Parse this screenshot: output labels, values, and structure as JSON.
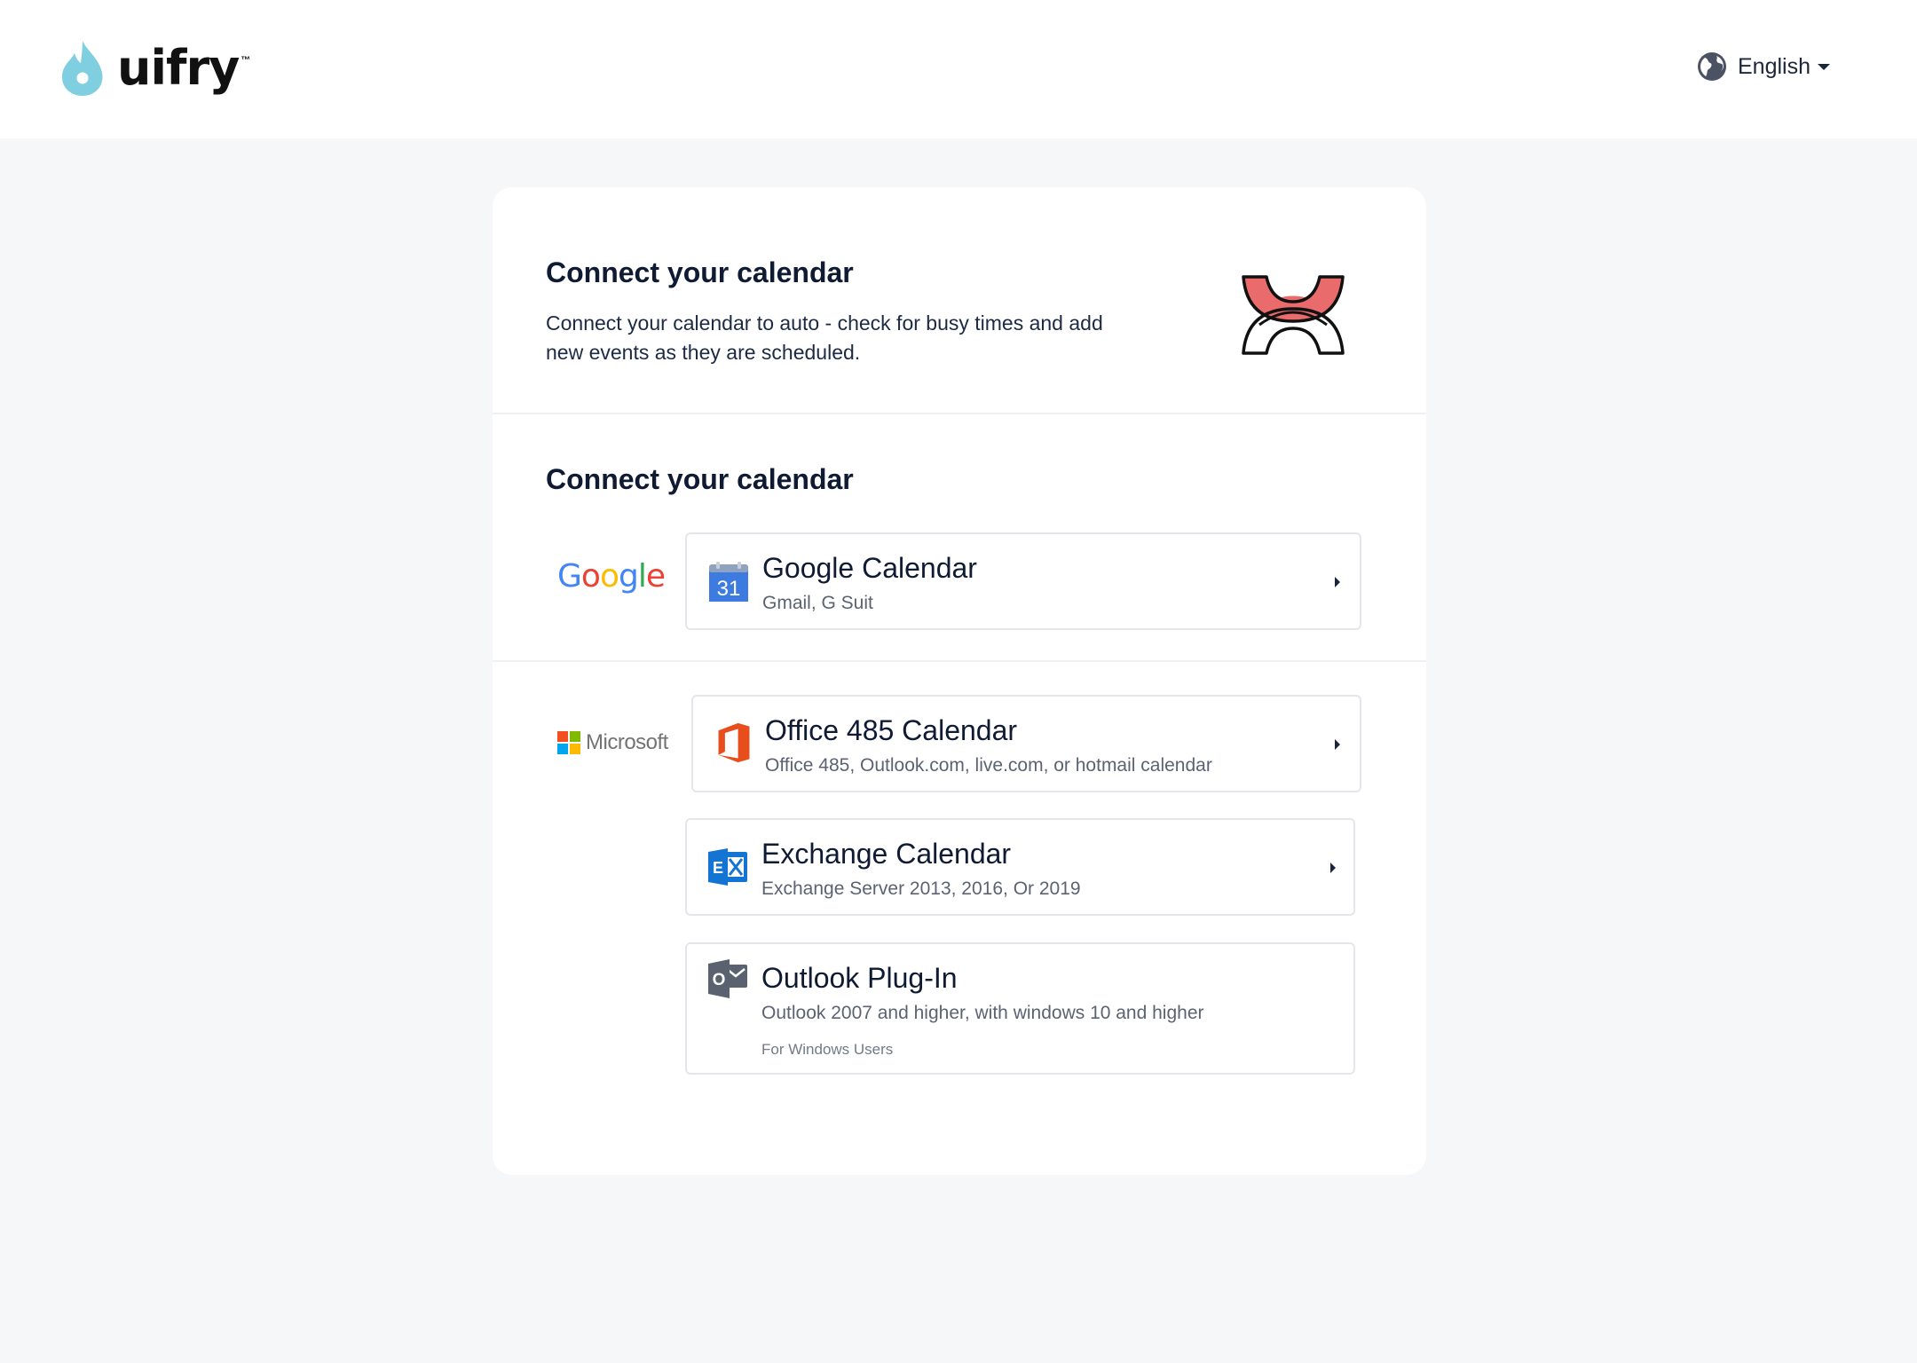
{
  "header": {
    "logo_text": "uifry",
    "logo_tm": "™",
    "language": "English"
  },
  "intro": {
    "title": "Connect your calendar",
    "description": "Connect your calendar to auto - check for busy times and add new events as they are scheduled."
  },
  "providers": {
    "title": "Connect your calendar",
    "google": {
      "brand_label": "Google",
      "options": [
        {
          "title": "Google Calendar",
          "subtitle": "Gmail, G Suit",
          "icon_day": "31",
          "icon": "google-calendar-icon"
        }
      ]
    },
    "microsoft": {
      "brand_label": "Microsoft",
      "options": [
        {
          "title": "Office 485 Calendar",
          "subtitle": "Office 485, Outlook.com, live.com, or hotmail calendar",
          "icon": "office-icon"
        },
        {
          "title": "Exchange Calendar",
          "subtitle": "Exchange Server 2013, 2016, Or 2019",
          "icon": "exchange-icon"
        },
        {
          "title": "Outlook Plug-In",
          "subtitle": "Outlook 2007 and higher, with windows 10 and higher",
          "note": "For Windows Users",
          "icon": "outlook-icon"
        }
      ]
    }
  },
  "colors": {
    "page_background": "#f6f7f9",
    "card_background": "#ffffff",
    "logo_accent": "#7fcfe0",
    "hero_accent": "#e96b6b",
    "office_red": "#e84d1c",
    "exchange_blue": "#1474d4",
    "outlook_gray": "#5a6270"
  }
}
